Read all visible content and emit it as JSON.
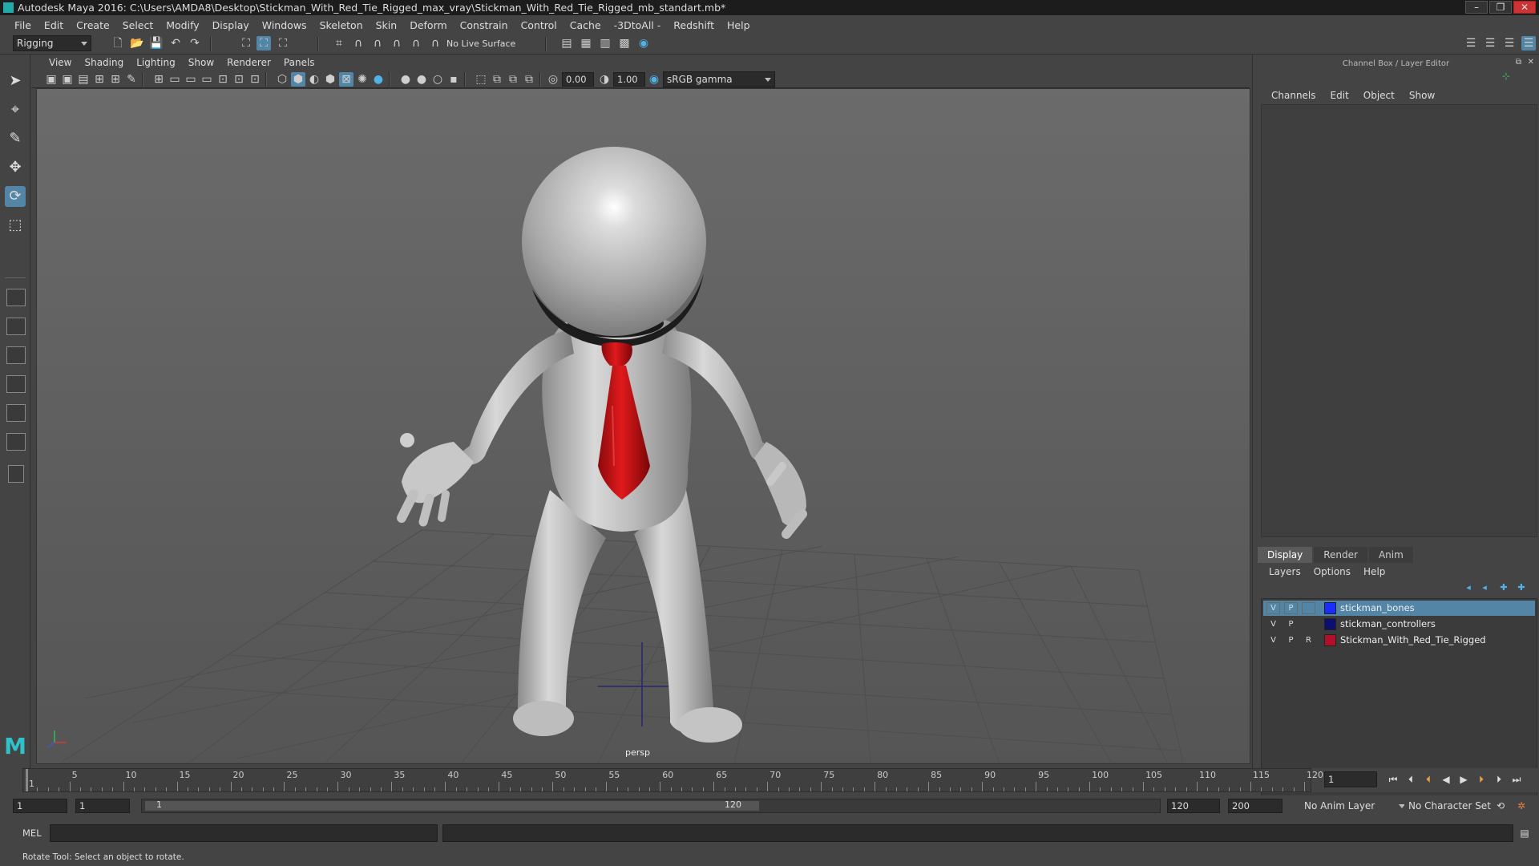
{
  "window": {
    "title": "Autodesk Maya 2016: C:\\Users\\AMDA8\\Desktop\\Stickman_With_Red_Tie_Rigged_max_vray\\Stickman_With_Red_Tie_Rigged_mb_standart.mb*"
  },
  "menubar": {
    "items": [
      "File",
      "Edit",
      "Create",
      "Select",
      "Modify",
      "Display",
      "Windows",
      "Skeleton",
      "Skin",
      "Deform",
      "Constrain",
      "Control",
      "Cache",
      "-3DtoAll -",
      "Redshift",
      "Help"
    ]
  },
  "shelf": {
    "mode": "Rigging",
    "live_surface": "No Live Surface"
  },
  "viewport": {
    "menu": [
      "View",
      "Shading",
      "Lighting",
      "Show",
      "Renderer",
      "Panels"
    ],
    "exposure": "0.00",
    "gamma": "1.00",
    "color_space": "sRGB gamma",
    "camera_label": "persp"
  },
  "channel_box": {
    "title": "Channel Box / Layer Editor",
    "menu": [
      "Channels",
      "Edit",
      "Object",
      "Show"
    ]
  },
  "layer_editor": {
    "tabs": [
      "Display",
      "Render",
      "Anim"
    ],
    "active_tab": "Display",
    "menu": [
      "Layers",
      "Options",
      "Help"
    ],
    "layers": [
      {
        "v": "V",
        "p": "P",
        "r": "",
        "name": "stickman_bones",
        "color": "#1a2cff",
        "selected": true
      },
      {
        "v": "V",
        "p": "P",
        "r": "",
        "name": "stickman_controllers",
        "color": "#0d0f6e",
        "selected": false
      },
      {
        "v": "V",
        "p": "P",
        "r": "R",
        "name": "Stickman_With_Red_Tie_Rigged",
        "color": "#b0102a",
        "selected": false
      }
    ]
  },
  "timeline": {
    "tick_labels": [
      "1",
      "5",
      "10",
      "15",
      "20",
      "25",
      "30",
      "35",
      "40",
      "45",
      "50",
      "55",
      "60",
      "65",
      "70",
      "75",
      "80",
      "85",
      "90",
      "95",
      "100",
      "105",
      "110",
      "115",
      "120"
    ],
    "current_frame": "1"
  },
  "range": {
    "start": "1",
    "anim_start": "1",
    "slider_start": "1",
    "slider_end": "120",
    "end": "120",
    "anim_end": "200",
    "anim_layer": "No Anim Layer",
    "character_set": "No Character Set"
  },
  "command": {
    "lang": "MEL"
  },
  "help": {
    "text": "Rotate Tool: Select an object to rotate."
  },
  "colors": {
    "selection": "#5285a6",
    "tie": "#c81214"
  }
}
